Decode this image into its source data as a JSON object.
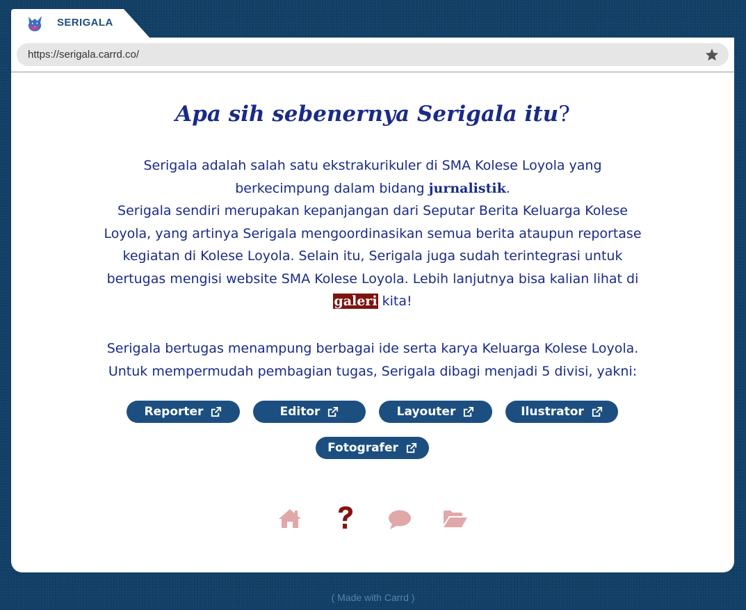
{
  "tab": {
    "title": "SERIGALA",
    "logo_icon": "wolf-logo-icon"
  },
  "address_bar": {
    "url": "https://serigala.carrd.co/",
    "bookmark_icon": "star-icon"
  },
  "content": {
    "heading": {
      "main": "Apa sih sebenernya Serigala itu",
      "mark": "?"
    },
    "paragraph1": {
      "line1": "Serigala adalah salah satu ekstrakurikuler di SMA Kolese Loyola yang berkecimpung dalam bidang ",
      "bold": "jurnalistik",
      "line1_end": ".",
      "line2": "Serigala sendiri merupakan kepanjangan dari Seputar Berita Keluarga Kolese Loyola, yang artinya Serigala mengoordinasikan semua berita ataupun reportase kegiatan di Kolese Loyola. Selain itu, Serigala juga sudah terintegrasi untuk bertugas mengisi website SMA Kolese Loyola. Lebih lanjutnya bisa kalian lihat di ",
      "link": "galeri",
      "line2_end": " kita!"
    },
    "paragraph2": "Serigala bertugas menampung berbagai ide serta karya Keluarga Kolese Loyola. Untuk mempermudah pembagian tugas, Serigala dibagi menjadi 5 divisi, yakni:",
    "divisions": [
      {
        "label": "Reporter",
        "icon": "external-link-icon"
      },
      {
        "label": "Editor",
        "icon": "external-link-icon"
      },
      {
        "label": "Layouter",
        "icon": "external-link-icon"
      },
      {
        "label": "Ilustrator",
        "icon": "external-link-icon"
      },
      {
        "label": "Fotografer",
        "icon": "external-link-icon"
      }
    ]
  },
  "nav": {
    "items": [
      {
        "icon": "home-icon",
        "active": false
      },
      {
        "icon": "question-icon",
        "active": true
      },
      {
        "icon": "comment-icon",
        "active": false
      },
      {
        "icon": "folder-open-icon",
        "active": false
      }
    ],
    "active_color": "#8a1010",
    "inactive_color": "#e0a8a8"
  },
  "colors": {
    "background": "#123f66",
    "accent": "#1c4f80",
    "text": "#1a2b86",
    "link_bg": "#7d1410"
  },
  "footer": "( Made with Carrd )"
}
